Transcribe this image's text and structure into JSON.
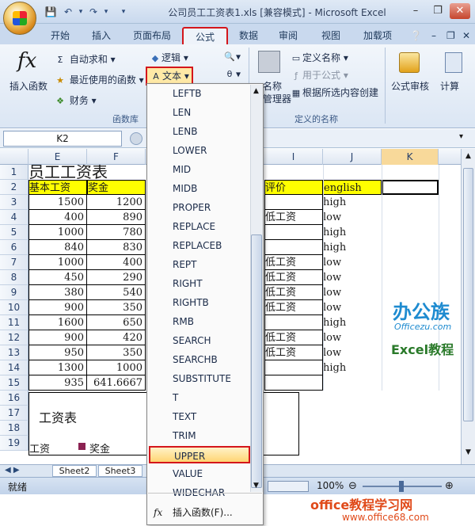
{
  "window": {
    "title": "公司员工工资表1.xls  [兼容模式] - Microsoft Excel"
  },
  "tabs": [
    "开始",
    "插入",
    "页面布局",
    "公式",
    "数据",
    "审阅",
    "视图",
    "加载项"
  ],
  "ribbon": {
    "insert_function": "插入函数",
    "autosum": "自动求和",
    "recent": "最近使用的函数",
    "finance": "财务",
    "logic": "逻辑",
    "text": "文本",
    "library_label": "函数库",
    "name_mgr_1": "名称",
    "name_mgr_2": "管理器",
    "define_name": "定义名称",
    "use_in_formula": "用于公式",
    "create_from_sel": "根据所选内容创建",
    "defined_names_label": "定义的名称",
    "audit": "公式审核",
    "calc": "计算"
  },
  "formula_bar": {
    "name_box": "K2"
  },
  "columns": [
    "E",
    "F",
    "I",
    "J",
    "K"
  ],
  "rows": [
    "1",
    "2",
    "3",
    "4",
    "5",
    "6",
    "7",
    "8",
    "9",
    "10",
    "11",
    "12",
    "13",
    "14",
    "15",
    "16",
    "17",
    "18",
    "19"
  ],
  "sheet": {
    "title": "员工工资表",
    "headers": {
      "e": "基本工资",
      "f": "奖金",
      "i": "评价",
      "j": "english"
    },
    "e": [
      "1500",
      "400",
      "1000",
      "840",
      "1000",
      "450",
      "380",
      "900",
      "1600",
      "900",
      "950",
      "1300",
      "935"
    ],
    "f": [
      "1200",
      "890",
      "780",
      "830",
      "400",
      "290",
      "540",
      "350",
      "650",
      "420",
      "350",
      "1000",
      "641.6667"
    ],
    "h_fragment": [
      "0",
      "5",
      "",
      "",
      "5",
      "0",
      "0",
      "5",
      "0",
      "0",
      "5",
      "",
      "9"
    ],
    "i": [
      "",
      "低工资",
      "",
      "",
      "低工资",
      "低工资",
      "低工资",
      "低工资",
      "",
      "低工资",
      "低工资",
      "",
      ""
    ],
    "j": [
      "high",
      "low",
      "high",
      "high",
      "low",
      "low",
      "low",
      "low",
      "high",
      "low",
      "low",
      "high",
      ""
    ],
    "chart_title": "工资表",
    "legend_1": "工资",
    "legend_2": "奖金"
  },
  "menu": {
    "items": [
      "LEFTB",
      "LEN",
      "LENB",
      "LOWER",
      "MID",
      "MIDB",
      "PROPER",
      "REPLACE",
      "REPLACEB",
      "REPT",
      "RIGHT",
      "RIGHTB",
      "RMB",
      "SEARCH",
      "SEARCHB",
      "SUBSTITUTE",
      "T",
      "TEXT",
      "TRIM",
      "UPPER",
      "VALUE",
      "WIDECHAR"
    ],
    "highlighted": "UPPER",
    "insert_function": "插入函数(F)..."
  },
  "sheet_tabs": [
    "Sheet2",
    "Sheet3"
  ],
  "status": {
    "ready": "就绪",
    "zoom": "100%"
  },
  "watermark": {
    "brand": "办公族",
    "site": "Officezu.com",
    "tag": "Excel教程",
    "footer_1": "office教程学习网",
    "footer_2": "www.office68.com"
  },
  "colors": {
    "accent_red": "#d4161b",
    "header_yellow": "#ffff00",
    "ribbon_blue": "#c9d9ee"
  }
}
